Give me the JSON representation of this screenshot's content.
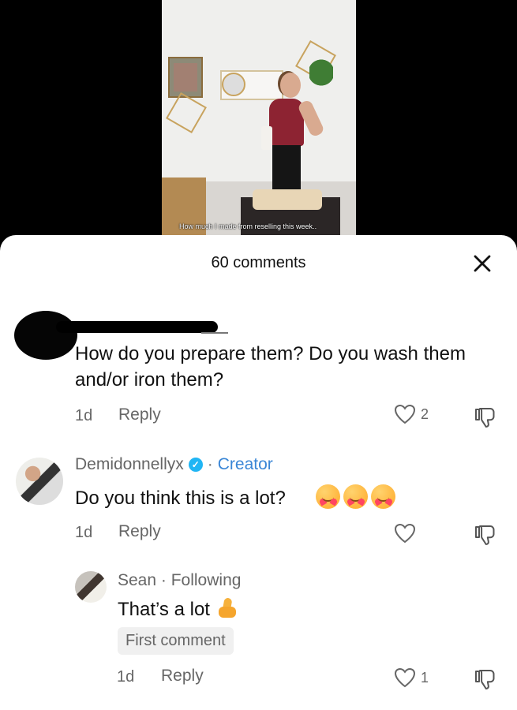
{
  "video": {
    "caption": "How much I made from reselling this week.."
  },
  "sheet": {
    "comments_count": "60 comments"
  },
  "comments": [
    {
      "text": "How do you prepare them? Do you wash them and/or iron them?",
      "age": "1d",
      "reply_label": "Reply",
      "like_count": "2"
    },
    {
      "author": "Demidonnellyx",
      "creator_label": "Creator",
      "text": "Do you think this is a lot?",
      "age": "1d",
      "reply_label": "Reply"
    },
    {
      "author": "Sean",
      "following_label": "Following",
      "text": "That’s a lot",
      "badge": "First comment",
      "age": "1d",
      "reply_label": "Reply",
      "like_count": "1"
    }
  ],
  "icons": {
    "close": "close-icon",
    "heart": "heart-icon",
    "dislike": "dislike-icon",
    "verified": "verified-icon"
  },
  "colors": {
    "creator": "#3a86d6",
    "verified": "#20b5f4",
    "muted": "#666666"
  }
}
